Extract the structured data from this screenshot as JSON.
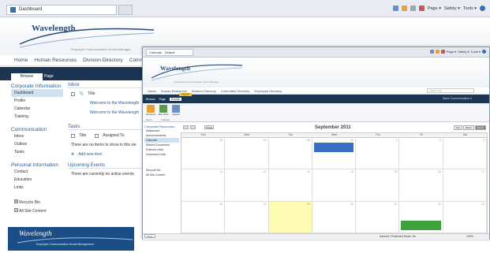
{
  "back": {
    "tab_title": "Dashboard",
    "toolbar": [
      "Page ▾",
      "Safety ▾",
      "Tools ▾"
    ],
    "logo": "Wavelength",
    "tagline": "Employee Communication Social Manager",
    "nav": [
      "Home",
      "Human Resources",
      "Division Directory",
      "Committee"
    ],
    "ribbon_tabs": [
      "Browse",
      "Page"
    ],
    "sidebar": {
      "group1": "Corporate Information",
      "items1": [
        "Dashboard",
        "Profile",
        "Calendar",
        "Training"
      ],
      "group2": "Communication",
      "items2": [
        "Inbox",
        "Outbox",
        "Tasks"
      ],
      "group3": "Personal Information",
      "items3": [
        "Contact",
        "Education",
        "Links"
      ],
      "bottom": [
        "Recycle Bin",
        "All Site Content"
      ]
    },
    "inbox": {
      "heading": "Inbox",
      "col": "Title",
      "rows": [
        "Welcome to the Wavelength",
        "Welcome to the Wavelength"
      ]
    },
    "tasks": {
      "heading": "Tasks",
      "col_title": "Title",
      "col_assigned": "Assigned To",
      "empty": "There are no items to show in this vie",
      "add": "Add new item"
    },
    "events": {
      "heading": "Upcoming Events",
      "empty": "There are currently no active events."
    },
    "footer": {
      "logo": "Wavelength",
      "tagline": "Employee Communication Social Management"
    }
  },
  "front": {
    "tab_title": "Calendar - Default",
    "toolbar": [
      "Page ▾",
      "Safety ▾",
      "Tools ▾"
    ],
    "logo": "Wavelength",
    "tagline": "Employee Communication Social Manager",
    "nav": [
      "Home",
      "Human Resources",
      "Division Directory",
      "Committee Directory",
      "Employee Directory"
    ],
    "search_placeholder": "Search site",
    "tools_tab": "Calendar Tools",
    "ribbon_tabs": [
      "Browse",
      "Page",
      "Events"
    ],
    "user": "Wave Communication ▾",
    "ribbon_buttons": [
      "New Event",
      "Filter Views",
      "Upgrade"
    ],
    "ribbon_groups": [
      "Events",
      "Calendar"
    ],
    "sidebar": {
      "group1": "Corporate Resources",
      "items": [
        "Dashboard",
        "Announcements",
        "Calendar",
        "Shared Documents",
        "External Links",
        "Document Links"
      ],
      "bottom": [
        "Recycle Bin",
        "All Site Content"
      ]
    },
    "calendar": {
      "today_button": "Today",
      "title": "September 2011",
      "views": [
        "Day",
        "Week",
        "Month"
      ],
      "weekdays": [
        "Sun",
        "Mon",
        "Tue",
        "Wed",
        "Thu",
        "Fri",
        "Sat"
      ],
      "weeks": [
        [
          "28",
          "29",
          "30",
          "31",
          "1",
          "2",
          "3"
        ],
        [
          "11",
          "12",
          "13",
          "14",
          "15",
          "16",
          "17"
        ],
        [
          "18",
          "19",
          "20",
          "21",
          "22",
          "23",
          "24"
        ]
      ]
    },
    "status": {
      "done": "Done",
      "zone": "Internet | Protected Mode: On",
      "zoom": "100%"
    }
  },
  "colors": {
    "brand_dark": "#1b3553",
    "link": "#2a5d99",
    "event_blue": "#3b6fc4",
    "event_green": "#3ea23e",
    "today": "#fffbb5"
  }
}
